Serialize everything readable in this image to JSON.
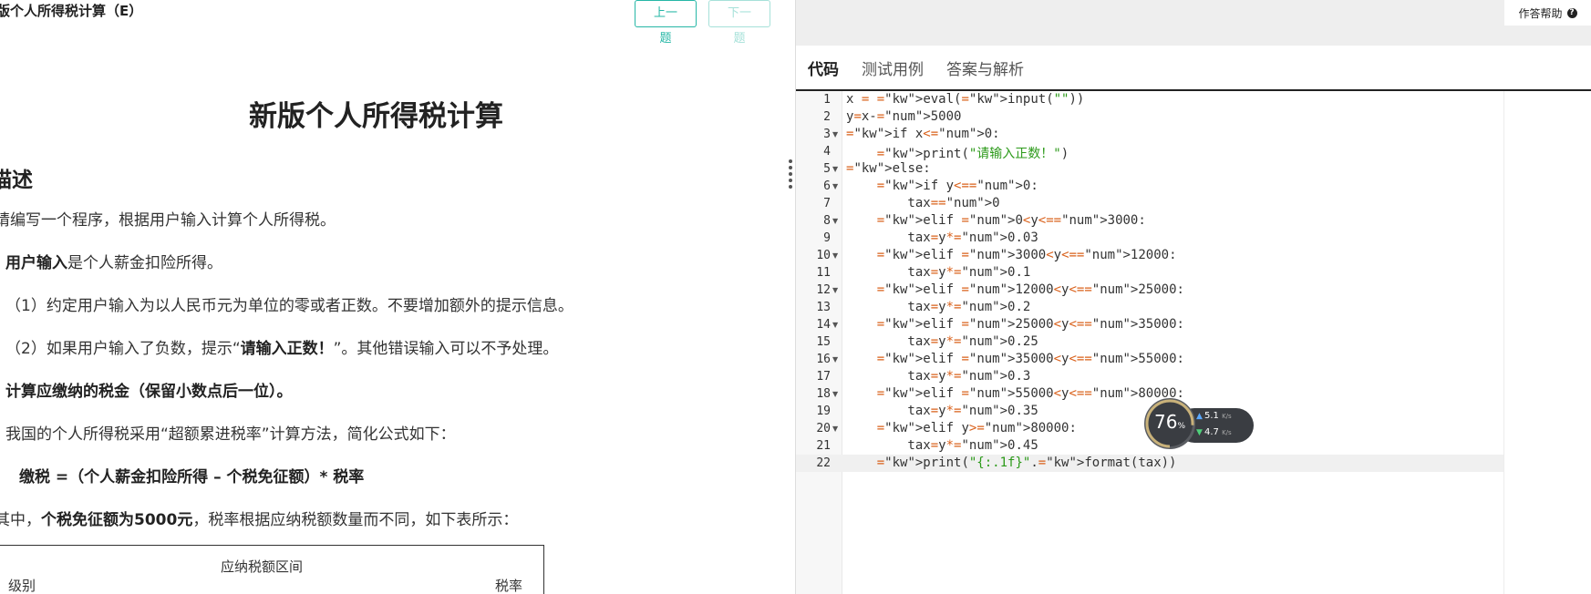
{
  "left": {
    "breadcrumb": "版个人所得税计算（E）",
    "prev_label": "上一题",
    "next_label": "下一题",
    "title": "新版个人所得税计算",
    "section_heading": "描述",
    "intro": "请编写一个程序，根据用户输入计算个人所得税。",
    "input_bold": "用户输入",
    "input_rest": "是个人薪金扣险所得。",
    "rule1": "（1）约定用户输入为以人民币元为单位的零或者正数。不要增加额外的提示信息。",
    "rule2_a": "（2）如果用户输入了负数，提示“",
    "rule2_bold": "请输入正数！",
    "rule2_b": "”。其他错误输入可以不予处理。",
    "calc_line": "计算应缴纳的税金（保留小数点后一位）。",
    "method_line": "我国的个人所得税采用“超额累进税率”计算方法，简化公式如下：",
    "formula": "缴税 =（个人薪金扣险所得 – 个税免征额）* 税率",
    "note_a": "其中，",
    "note_bold": "个税免征额为5000元",
    "note_b": "，税率根据应纳税额数量而不同，如下表所示：",
    "table": {
      "header_mid": "应纳税额区间",
      "col_level": "级别",
      "col_rate": "税率"
    }
  },
  "right": {
    "help_label": "作答帮助",
    "help_icon": "question-icon",
    "tabs": [
      {
        "label": "代码"
      },
      {
        "label": "测试用例"
      },
      {
        "label": "答案与解析"
      }
    ],
    "line_numbers": [
      "1",
      "2",
      "3",
      "4",
      "5",
      "6",
      "7",
      "8",
      "9",
      "10",
      "11",
      "12",
      "13",
      "14",
      "15",
      "16",
      "17",
      "18",
      "19",
      "20",
      "21",
      "22"
    ],
    "code_lines": [
      "x = eval(input(\"\"))",
      "y=x-5000",
      "if x<0:",
      "    print(\"请输入正数！\")",
      "else:",
      "    if y<=0:",
      "        tax=0",
      "    elif 0<y<=3000:",
      "        tax=y*0.03",
      "    elif 3000<y<=12000:",
      "        tax=y*0.1",
      "    elif 12000<y<=25000:",
      "        tax=y*0.2",
      "    elif 25000<y<=35000:",
      "        tax=y*0.25",
      "    elif 35000<y<=55000:",
      "        tax=y*0.3",
      "    elif 55000<y<=80000:",
      "        tax=y*0.35",
      "    elif y>80000:",
      "        tax=y*0.45",
      "    print(\"{:.1f}\".format(tax))"
    ],
    "fold_lines": [
      3,
      5,
      6,
      8,
      10,
      12,
      14,
      16,
      18,
      20
    ],
    "active_line": 22
  },
  "widget": {
    "percent": "76",
    "percent_unit": "%",
    "up_speed": "5.1",
    "down_speed": "4.7",
    "speed_unit": "K/s"
  },
  "colors": {
    "accent": "#26b7a6",
    "keyword": "#d9601a",
    "string": "#2c9a1a"
  }
}
